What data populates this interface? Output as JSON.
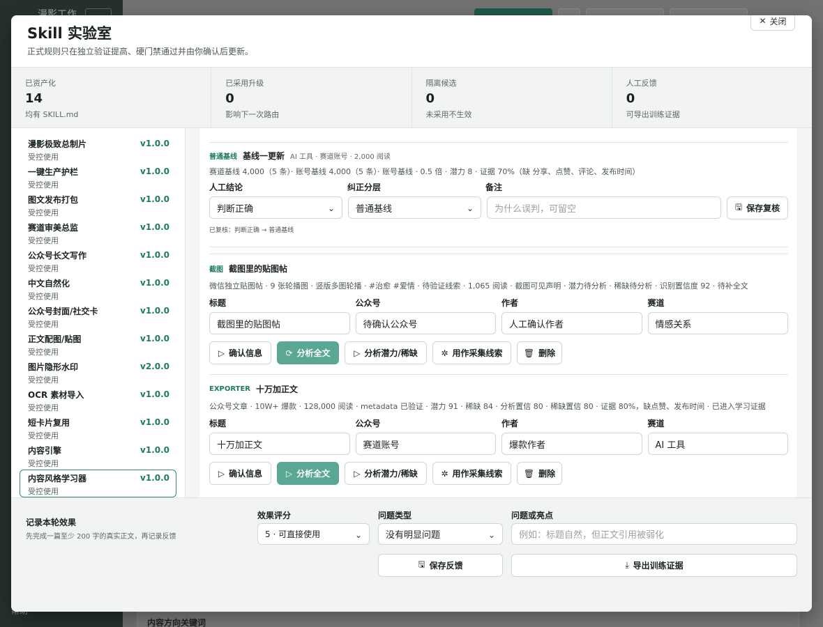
{
  "background": {
    "brand": "漫影工作",
    "bottom_label": "内容方向关键词",
    "sidebar_footer": "帮助"
  },
  "modal": {
    "title": "Skill 实验室",
    "subtitle": "正式规则只在独立验证提高、硬门禁通过并由你确认后更新。",
    "close_label": "关闭"
  },
  "stats": [
    {
      "label": "已资产化",
      "value": "14",
      "note": "均有 SKILL.md"
    },
    {
      "label": "已采用升级",
      "value": "0",
      "note": "影响下一次路由"
    },
    {
      "label": "隔离候选",
      "value": "0",
      "note": "未采用不生效"
    },
    {
      "label": "人工反馈",
      "value": "0",
      "note": "可导出训练证据"
    }
  ],
  "skills": [
    {
      "name": "漫影极致总制片",
      "version": "v1.0.0",
      "status": "受控使用"
    },
    {
      "name": "一键生产护栏",
      "version": "v1.0.0",
      "status": "受控使用"
    },
    {
      "name": "图文发布打包",
      "version": "v1.0.0",
      "status": "受控使用"
    },
    {
      "name": "赛道审美总监",
      "version": "v1.0.0",
      "status": "受控使用"
    },
    {
      "name": "公众号长文写作",
      "version": "v1.0.0",
      "status": "受控使用"
    },
    {
      "name": "中文自然化",
      "version": "v1.0.0",
      "status": "受控使用"
    },
    {
      "name": "公众号封面/社交卡",
      "version": "v1.0.0",
      "status": "受控使用"
    },
    {
      "name": "正文配图/贴图",
      "version": "v1.0.0",
      "status": "受控使用"
    },
    {
      "name": "图片隐形水印",
      "version": "v2.0.0",
      "status": "受控使用"
    },
    {
      "name": "OCR 素材导入",
      "version": "v1.0.0",
      "status": "受控使用"
    },
    {
      "name": "短卡片复用",
      "version": "v1.0.0",
      "status": "受控使用"
    },
    {
      "name": "内容引擎",
      "version": "v1.0.0",
      "status": "受控使用"
    },
    {
      "name": "内容风格学习器",
      "version": "v1.0.0",
      "status": "受控使用"
    }
  ],
  "baseline": {
    "tag": "普通基线",
    "title": "基线一更新",
    "meta": "AI 工具 · 赛道账号 · 2,000 阅读",
    "desc": "赛道基线 4,000（5 条）· 账号基线 4,000（5 条）· 账号基线 · 0.5 倍 · 潜力 8 · 证据 70%（缺 分享、点赞、评论、发布时间）",
    "conclusion_label": "人工结论",
    "conclusion_value": "判断正确",
    "layer_label": "纠正分层",
    "layer_value": "普通基线",
    "note_label": "备注",
    "note_placeholder": "为什么误判，可留空",
    "save_label": "保存复核",
    "reviewed": "已复核：判断正确 → 普通基线"
  },
  "articles": [
    {
      "tag": "截图",
      "title": "截图里的贴图帖",
      "desc": "微信独立贴图帖 · 9 张轮播图 · 竖版多图轮播 · #治愈 #爱情 · 待验证线索 · 1,065 阅读 · 截图可见声明 · 潜力待分析 · 稀缺待分析 · 识别置信度 92 · 待补全文",
      "fields": [
        {
          "label": "标题",
          "value": "截图里的贴图帖"
        },
        {
          "label": "公众号",
          "value": "待确认公众号"
        },
        {
          "label": "作者",
          "value": "人工确认作者"
        },
        {
          "label": "赛道",
          "value": "情感关系"
        }
      ],
      "buttons": {
        "confirm": "确认信息",
        "analyze": "分析全文",
        "potential": "分析潜力/稀缺",
        "collect": "用作采集线索",
        "delete": "删除"
      }
    },
    {
      "tag": "EXPORTER",
      "title": "十万加正文",
      "desc": "公众号文章 · 10W+ 爆款 · 128,000 阅读 · metadata 已验证 · 潜力 91 · 稀缺 84 · 分析置信 80 · 稀缺置信 80 · 证据 80%，缺点赞、发布时间 · 已进入学习证据",
      "fields": [
        {
          "label": "标题",
          "value": "十万加正文"
        },
        {
          "label": "公众号",
          "value": "赛道账号"
        },
        {
          "label": "作者",
          "value": "爆款作者"
        },
        {
          "label": "赛道",
          "value": "AI 工具"
        }
      ],
      "buttons": {
        "confirm": "确认信息",
        "analyze": "分析全文",
        "potential": "分析潜力/稀缺",
        "collect": "用作采集线索",
        "delete": "删除"
      }
    }
  ],
  "footer": {
    "title": "记录本轮效果",
    "subtitle": "先完成一篇至少 200 字的真实正文，再记录反馈",
    "score_label": "效果评分",
    "score_value": "5 · 可直接使用",
    "issue_label": "问题类型",
    "issue_value": "没有明显问题",
    "highlight_label": "问题或亮点",
    "highlight_placeholder": "例如：标题自然，但正文引用被弱化",
    "save_label": "保存反馈",
    "export_label": "导出训练证据"
  }
}
